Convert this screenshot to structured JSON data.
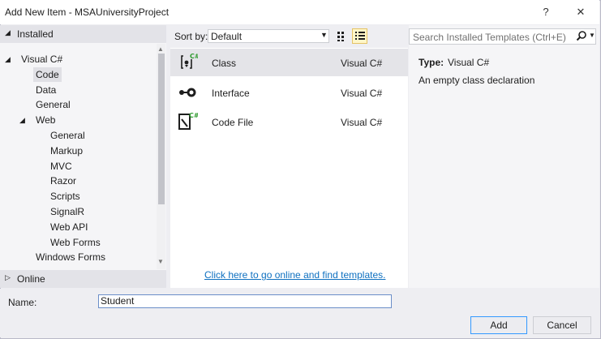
{
  "window": {
    "title": "Add New Item - MSAUniversityProject",
    "help_label": "?",
    "close_label": "✕"
  },
  "left": {
    "installed_header": "Installed",
    "online_header": "Online",
    "tree": [
      {
        "label": "Visual C#",
        "level": 0,
        "expander": "◢",
        "selected": false
      },
      {
        "label": "Code",
        "level": 1,
        "expander": "",
        "selected": true
      },
      {
        "label": "Data",
        "level": 1,
        "expander": "",
        "selected": false
      },
      {
        "label": "General",
        "level": 1,
        "expander": "",
        "selected": false
      },
      {
        "label": "Web",
        "level": 1,
        "expander": "◢",
        "selected": false
      },
      {
        "label": "General",
        "level": 2,
        "expander": "",
        "selected": false
      },
      {
        "label": "Markup",
        "level": 2,
        "expander": "",
        "selected": false
      },
      {
        "label": "MVC",
        "level": 2,
        "expander": "",
        "selected": false
      },
      {
        "label": "Razor",
        "level": 2,
        "expander": "",
        "selected": false
      },
      {
        "label": "Scripts",
        "level": 2,
        "expander": "",
        "selected": false
      },
      {
        "label": "SignalR",
        "level": 2,
        "expander": "",
        "selected": false
      },
      {
        "label": "Web API",
        "level": 2,
        "expander": "",
        "selected": false
      },
      {
        "label": "Web Forms",
        "level": 2,
        "expander": "",
        "selected": false
      },
      {
        "label": "Windows Forms",
        "level": 1,
        "expander": "",
        "selected": false
      }
    ]
  },
  "sort": {
    "label": "Sort by:",
    "value": "Default"
  },
  "templates": [
    {
      "name": "Class",
      "language": "Visual C#",
      "selected": true,
      "icon": "class-icon"
    },
    {
      "name": "Interface",
      "language": "Visual C#",
      "selected": false,
      "icon": "interface-icon"
    },
    {
      "name": "Code File",
      "language": "Visual C#",
      "selected": false,
      "icon": "code-file-icon"
    }
  ],
  "online_link": "Click here to go online and find templates.",
  "search": {
    "placeholder": "Search Installed Templates (Ctrl+E)"
  },
  "details": {
    "type_label": "Type:",
    "type_value": "Visual C#",
    "description": "An empty class declaration"
  },
  "footer": {
    "name_label": "Name:",
    "name_value": "Student",
    "add_label": "Add",
    "cancel_label": "Cancel"
  },
  "colors": {
    "accent": "#3399ff",
    "link": "#0e70c0",
    "csharp_green": "#2e9a2e"
  }
}
